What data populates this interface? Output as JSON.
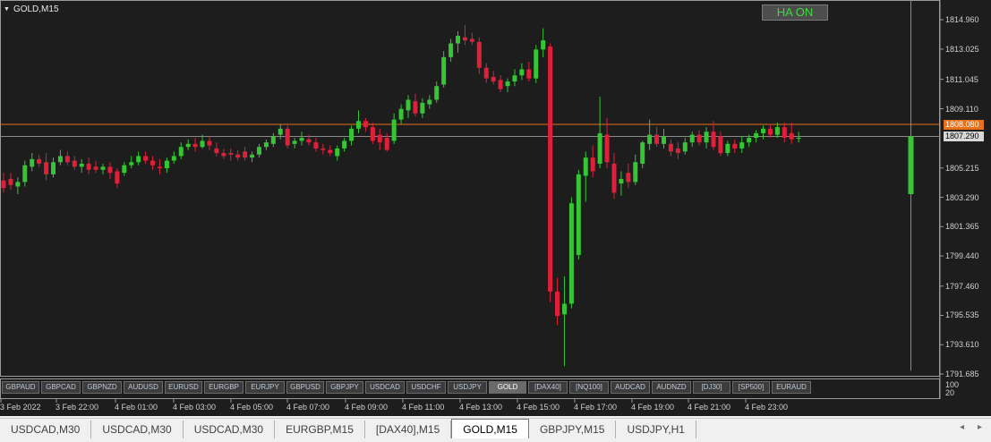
{
  "window": {
    "title": "GOLD,M15"
  },
  "ha_button": {
    "label": "HA ON"
  },
  "colors": {
    "bull": "#35c535",
    "bear": "#e0203a",
    "ask_line": "#e8701a",
    "bid_line": "#8a8a8a",
    "background": "#1d1d1d"
  },
  "price_axis": {
    "labels": [
      "1814.960",
      "1813.025",
      "1811.045",
      "1809.110",
      "1805.215",
      "1803.290",
      "1801.365",
      "1799.440",
      "1797.460",
      "1795.535",
      "1793.610",
      "1791.685"
    ],
    "ask_price": "1808.080",
    "bid_price": "1807.290"
  },
  "time_axis": {
    "labels": [
      "3 Feb 2022",
      "3 Feb 22:00",
      "4 Feb 01:00",
      "4 Feb 03:00",
      "4 Feb 05:00",
      "4 Feb 07:00",
      "4 Feb 09:00",
      "4 Feb 11:00",
      "4 Feb 13:00",
      "4 Feb 15:00",
      "4 Feb 17:00",
      "4 Feb 19:00",
      "4 Feb 21:00",
      "4 Feb 23:00"
    ]
  },
  "indicator_axis": {
    "labels": [
      "100",
      "20"
    ]
  },
  "symbol_buttons": [
    "GBPAUD",
    "GBPCAD",
    "GBPNZD",
    "AUDUSD",
    "EURUSD",
    "EURGBP",
    "EURJPY",
    "GBPUSD",
    "GBPJPY",
    "USDCAD",
    "USDCHF",
    "USDJPY",
    "GOLD",
    "[DAX40]",
    "[NQ100]",
    "AUDCAD",
    "AUDNZD",
    "[DJ30]",
    "[SP500]",
    "EURAUD"
  ],
  "active_symbol": "GOLD",
  "tabs": [
    "USDCAD,M30",
    "USDCAD,M30",
    "USDCAD,M30",
    "EURGBP,M15",
    "[DAX40],M15",
    "GOLD,M15",
    "GBPJPY,M15",
    "USDJPY,H1"
  ],
  "active_tab": "GOLD,M15",
  "chart_data": {
    "type": "candlestick",
    "symbol": "GOLD",
    "timeframe": "M15",
    "ylim": [
      1791.685,
      1815.5
    ],
    "ask": 1808.08,
    "bid": 1807.29,
    "candles": [
      {
        "o": 1804.4,
        "h": 1804.9,
        "l": 1803.6,
        "c": 1803.9
      },
      {
        "o": 1804.5,
        "h": 1804.9,
        "l": 1803.8,
        "c": 1804.1
      },
      {
        "o": 1804.0,
        "h": 1804.6,
        "l": 1803.5,
        "c": 1804.3
      },
      {
        "o": 1804.3,
        "h": 1805.7,
        "l": 1804.0,
        "c": 1805.4
      },
      {
        "o": 1805.3,
        "h": 1806.2,
        "l": 1805.0,
        "c": 1805.8
      },
      {
        "o": 1805.8,
        "h": 1806.1,
        "l": 1805.3,
        "c": 1805.5
      },
      {
        "o": 1805.6,
        "h": 1806.2,
        "l": 1804.4,
        "c": 1804.8
      },
      {
        "o": 1804.8,
        "h": 1805.9,
        "l": 1804.6,
        "c": 1805.6
      },
      {
        "o": 1805.6,
        "h": 1806.4,
        "l": 1805.4,
        "c": 1806.0
      },
      {
        "o": 1806.0,
        "h": 1806.3,
        "l": 1805.4,
        "c": 1805.6
      },
      {
        "o": 1805.7,
        "h": 1806.0,
        "l": 1805.1,
        "c": 1805.3
      },
      {
        "o": 1805.3,
        "h": 1805.8,
        "l": 1804.9,
        "c": 1805.5
      },
      {
        "o": 1805.5,
        "h": 1805.9,
        "l": 1804.8,
        "c": 1805.1
      },
      {
        "o": 1805.3,
        "h": 1805.7,
        "l": 1804.9,
        "c": 1805.1
      },
      {
        "o": 1805.1,
        "h": 1805.5,
        "l": 1804.8,
        "c": 1805.3
      },
      {
        "o": 1805.3,
        "h": 1805.6,
        "l": 1804.5,
        "c": 1804.9
      },
      {
        "o": 1805.0,
        "h": 1805.2,
        "l": 1803.9,
        "c": 1804.2
      },
      {
        "o": 1804.9,
        "h": 1805.6,
        "l": 1804.7,
        "c": 1805.4
      },
      {
        "o": 1805.4,
        "h": 1806.0,
        "l": 1805.2,
        "c": 1805.6
      },
      {
        "o": 1805.6,
        "h": 1806.3,
        "l": 1805.4,
        "c": 1806.0
      },
      {
        "o": 1806.0,
        "h": 1806.3,
        "l": 1805.5,
        "c": 1805.7
      },
      {
        "o": 1805.7,
        "h": 1806.0,
        "l": 1805.1,
        "c": 1805.4
      },
      {
        "o": 1805.3,
        "h": 1805.8,
        "l": 1804.8,
        "c": 1805.2
      },
      {
        "o": 1805.2,
        "h": 1805.9,
        "l": 1804.9,
        "c": 1805.7
      },
      {
        "o": 1805.7,
        "h": 1806.3,
        "l": 1805.5,
        "c": 1806.0
      },
      {
        "o": 1806.0,
        "h": 1806.9,
        "l": 1805.8,
        "c": 1806.6
      },
      {
        "o": 1806.6,
        "h": 1807.1,
        "l": 1806.4,
        "c": 1806.8
      },
      {
        "o": 1806.8,
        "h": 1807.2,
        "l": 1806.3,
        "c": 1806.6
      },
      {
        "o": 1806.6,
        "h": 1807.4,
        "l": 1806.5,
        "c": 1807.0
      },
      {
        "o": 1807.0,
        "h": 1807.3,
        "l": 1806.4,
        "c": 1806.7
      },
      {
        "o": 1806.5,
        "h": 1806.9,
        "l": 1806.0,
        "c": 1806.2
      },
      {
        "o": 1806.2,
        "h": 1806.5,
        "l": 1805.8,
        "c": 1806.0
      },
      {
        "o": 1806.2,
        "h": 1806.5,
        "l": 1805.7,
        "c": 1806.1
      },
      {
        "o": 1806.1,
        "h": 1806.4,
        "l": 1805.7,
        "c": 1805.9
      },
      {
        "o": 1806.3,
        "h": 1806.6,
        "l": 1805.7,
        "c": 1805.9
      },
      {
        "o": 1805.9,
        "h": 1806.3,
        "l": 1805.6,
        "c": 1806.1
      },
      {
        "o": 1806.1,
        "h": 1806.8,
        "l": 1805.9,
        "c": 1806.6
      },
      {
        "o": 1806.6,
        "h": 1807.1,
        "l": 1806.4,
        "c": 1806.9
      },
      {
        "o": 1806.8,
        "h": 1807.5,
        "l": 1806.6,
        "c": 1807.3
      },
      {
        "o": 1807.4,
        "h": 1808.1,
        "l": 1807.1,
        "c": 1807.8
      },
      {
        "o": 1807.8,
        "h": 1808.0,
        "l": 1806.5,
        "c": 1806.7
      },
      {
        "o": 1806.8,
        "h": 1807.2,
        "l": 1806.5,
        "c": 1807.0
      },
      {
        "o": 1807.0,
        "h": 1807.6,
        "l": 1806.7,
        "c": 1807.2
      },
      {
        "o": 1807.1,
        "h": 1807.4,
        "l": 1806.7,
        "c": 1806.9
      },
      {
        "o": 1806.9,
        "h": 1807.2,
        "l": 1806.3,
        "c": 1806.5
      },
      {
        "o": 1806.5,
        "h": 1806.8,
        "l": 1806.1,
        "c": 1806.4
      },
      {
        "o": 1806.4,
        "h": 1806.7,
        "l": 1806.0,
        "c": 1806.2
      },
      {
        "o": 1806.0,
        "h": 1806.7,
        "l": 1805.7,
        "c": 1806.5
      },
      {
        "o": 1806.5,
        "h": 1807.2,
        "l": 1806.3,
        "c": 1807.0
      },
      {
        "o": 1807.0,
        "h": 1808.0,
        "l": 1806.7,
        "c": 1807.8
      },
      {
        "o": 1807.8,
        "h": 1809.0,
        "l": 1807.5,
        "c": 1808.3
      },
      {
        "o": 1808.3,
        "h": 1808.5,
        "l": 1807.6,
        "c": 1807.9
      },
      {
        "o": 1807.9,
        "h": 1808.2,
        "l": 1806.8,
        "c": 1807.0
      },
      {
        "o": 1807.4,
        "h": 1807.8,
        "l": 1806.4,
        "c": 1806.9
      },
      {
        "o": 1807.2,
        "h": 1807.5,
        "l": 1806.3,
        "c": 1806.4
      },
      {
        "o": 1807.0,
        "h": 1808.8,
        "l": 1806.8,
        "c": 1808.4
      },
      {
        "o": 1808.4,
        "h": 1809.4,
        "l": 1808.1,
        "c": 1809.1
      },
      {
        "o": 1809.0,
        "h": 1810.0,
        "l": 1808.5,
        "c": 1809.7
      },
      {
        "o": 1809.6,
        "h": 1810.1,
        "l": 1808.6,
        "c": 1808.8
      },
      {
        "o": 1808.8,
        "h": 1809.8,
        "l": 1808.5,
        "c": 1809.5
      },
      {
        "o": 1809.4,
        "h": 1810.0,
        "l": 1809.1,
        "c": 1809.7
      },
      {
        "o": 1809.7,
        "h": 1810.9,
        "l": 1809.5,
        "c": 1810.6
      },
      {
        "o": 1810.7,
        "h": 1812.9,
        "l": 1810.5,
        "c": 1812.5
      },
      {
        "o": 1812.5,
        "h": 1813.7,
        "l": 1812.2,
        "c": 1813.4
      },
      {
        "o": 1813.4,
        "h": 1814.2,
        "l": 1812.8,
        "c": 1813.9
      },
      {
        "o": 1813.8,
        "h": 1814.6,
        "l": 1813.3,
        "c": 1813.6
      },
      {
        "o": 1813.7,
        "h": 1814.1,
        "l": 1813.3,
        "c": 1813.5
      },
      {
        "o": 1813.5,
        "h": 1813.8,
        "l": 1811.4,
        "c": 1811.8
      },
      {
        "o": 1811.8,
        "h": 1812.1,
        "l": 1810.8,
        "c": 1811.1
      },
      {
        "o": 1811.2,
        "h": 1811.6,
        "l": 1810.7,
        "c": 1810.9
      },
      {
        "o": 1811.0,
        "h": 1811.3,
        "l": 1810.2,
        "c": 1810.4
      },
      {
        "o": 1810.6,
        "h": 1811.1,
        "l": 1810.2,
        "c": 1810.9
      },
      {
        "o": 1810.9,
        "h": 1811.7,
        "l": 1810.6,
        "c": 1811.3
      },
      {
        "o": 1811.3,
        "h": 1812.1,
        "l": 1811.0,
        "c": 1811.7
      },
      {
        "o": 1811.7,
        "h": 1812.2,
        "l": 1810.9,
        "c": 1811.1
      },
      {
        "o": 1811.1,
        "h": 1813.3,
        "l": 1810.8,
        "c": 1813.0
      },
      {
        "o": 1813.0,
        "h": 1814.4,
        "l": 1812.5,
        "c": 1813.6
      },
      {
        "o": 1813.2,
        "h": 1813.4,
        "l": 1796.4,
        "c": 1797.1
      },
      {
        "o": 1797.1,
        "h": 1798.0,
        "l": 1794.9,
        "c": 1795.5
      },
      {
        "o": 1795.6,
        "h": 1798.1,
        "l": 1792.2,
        "c": 1796.3
      },
      {
        "o": 1796.3,
        "h": 1803.3,
        "l": 1796.0,
        "c": 1802.9
      },
      {
        "o": 1799.5,
        "h": 1805.1,
        "l": 1799.2,
        "c": 1804.8
      },
      {
        "o": 1804.7,
        "h": 1806.3,
        "l": 1803.0,
        "c": 1805.9
      },
      {
        "o": 1805.9,
        "h": 1806.7,
        "l": 1804.6,
        "c": 1805.0
      },
      {
        "o": 1805.5,
        "h": 1809.9,
        "l": 1805.2,
        "c": 1807.5
      },
      {
        "o": 1807.4,
        "h": 1808.5,
        "l": 1805.2,
        "c": 1805.6
      },
      {
        "o": 1805.5,
        "h": 1806.2,
        "l": 1803.2,
        "c": 1803.6
      },
      {
        "o": 1804.2,
        "h": 1805.0,
        "l": 1803.4,
        "c": 1804.5
      },
      {
        "o": 1804.9,
        "h": 1805.5,
        "l": 1803.9,
        "c": 1804.3
      },
      {
        "o": 1804.3,
        "h": 1806.1,
        "l": 1804.1,
        "c": 1805.6
      },
      {
        "o": 1805.5,
        "h": 1807.0,
        "l": 1805.2,
        "c": 1806.9
      },
      {
        "o": 1806.8,
        "h": 1808.4,
        "l": 1806.4,
        "c": 1807.4
      },
      {
        "o": 1807.4,
        "h": 1807.9,
        "l": 1806.6,
        "c": 1806.8
      },
      {
        "o": 1806.8,
        "h": 1807.8,
        "l": 1806.5,
        "c": 1807.3
      },
      {
        "o": 1806.8,
        "h": 1807.1,
        "l": 1806.0,
        "c": 1806.3
      },
      {
        "o": 1806.5,
        "h": 1806.9,
        "l": 1805.8,
        "c": 1806.2
      },
      {
        "o": 1806.3,
        "h": 1807.2,
        "l": 1806.1,
        "c": 1806.9
      },
      {
        "o": 1806.9,
        "h": 1807.6,
        "l": 1806.6,
        "c": 1807.4
      },
      {
        "o": 1807.4,
        "h": 1807.7,
        "l": 1806.7,
        "c": 1806.9
      },
      {
        "o": 1806.9,
        "h": 1807.9,
        "l": 1806.5,
        "c": 1807.6
      },
      {
        "o": 1807.6,
        "h": 1808.3,
        "l": 1806.4,
        "c": 1806.6
      },
      {
        "o": 1807.3,
        "h": 1807.6,
        "l": 1806.0,
        "c": 1806.2
      },
      {
        "o": 1806.2,
        "h": 1807.0,
        "l": 1806.0,
        "c": 1806.8
      },
      {
        "o": 1806.8,
        "h": 1807.1,
        "l": 1806.2,
        "c": 1806.5
      },
      {
        "o": 1806.5,
        "h": 1807.3,
        "l": 1806.2,
        "c": 1806.9
      },
      {
        "o": 1806.9,
        "h": 1807.4,
        "l": 1806.6,
        "c": 1807.2
      },
      {
        "o": 1807.2,
        "h": 1807.7,
        "l": 1806.9,
        "c": 1807.5
      },
      {
        "o": 1807.5,
        "h": 1808.0,
        "l": 1807.1,
        "c": 1807.8
      },
      {
        "o": 1807.8,
        "h": 1808.1,
        "l": 1807.2,
        "c": 1807.4
      },
      {
        "o": 1807.4,
        "h": 1808.2,
        "l": 1807.2,
        "c": 1807.9
      },
      {
        "o": 1807.9,
        "h": 1808.2,
        "l": 1806.9,
        "c": 1807.2
      },
      {
        "o": 1807.5,
        "h": 1808.2,
        "l": 1806.8,
        "c": 1807.1
      },
      {
        "o": 1807.2,
        "h": 1807.6,
        "l": 1806.9,
        "c": 1807.2
      },
      {
        "o": 1803.5,
        "h": 1816.4,
        "l": 1791.9,
        "c": 1807.3
      }
    ]
  }
}
